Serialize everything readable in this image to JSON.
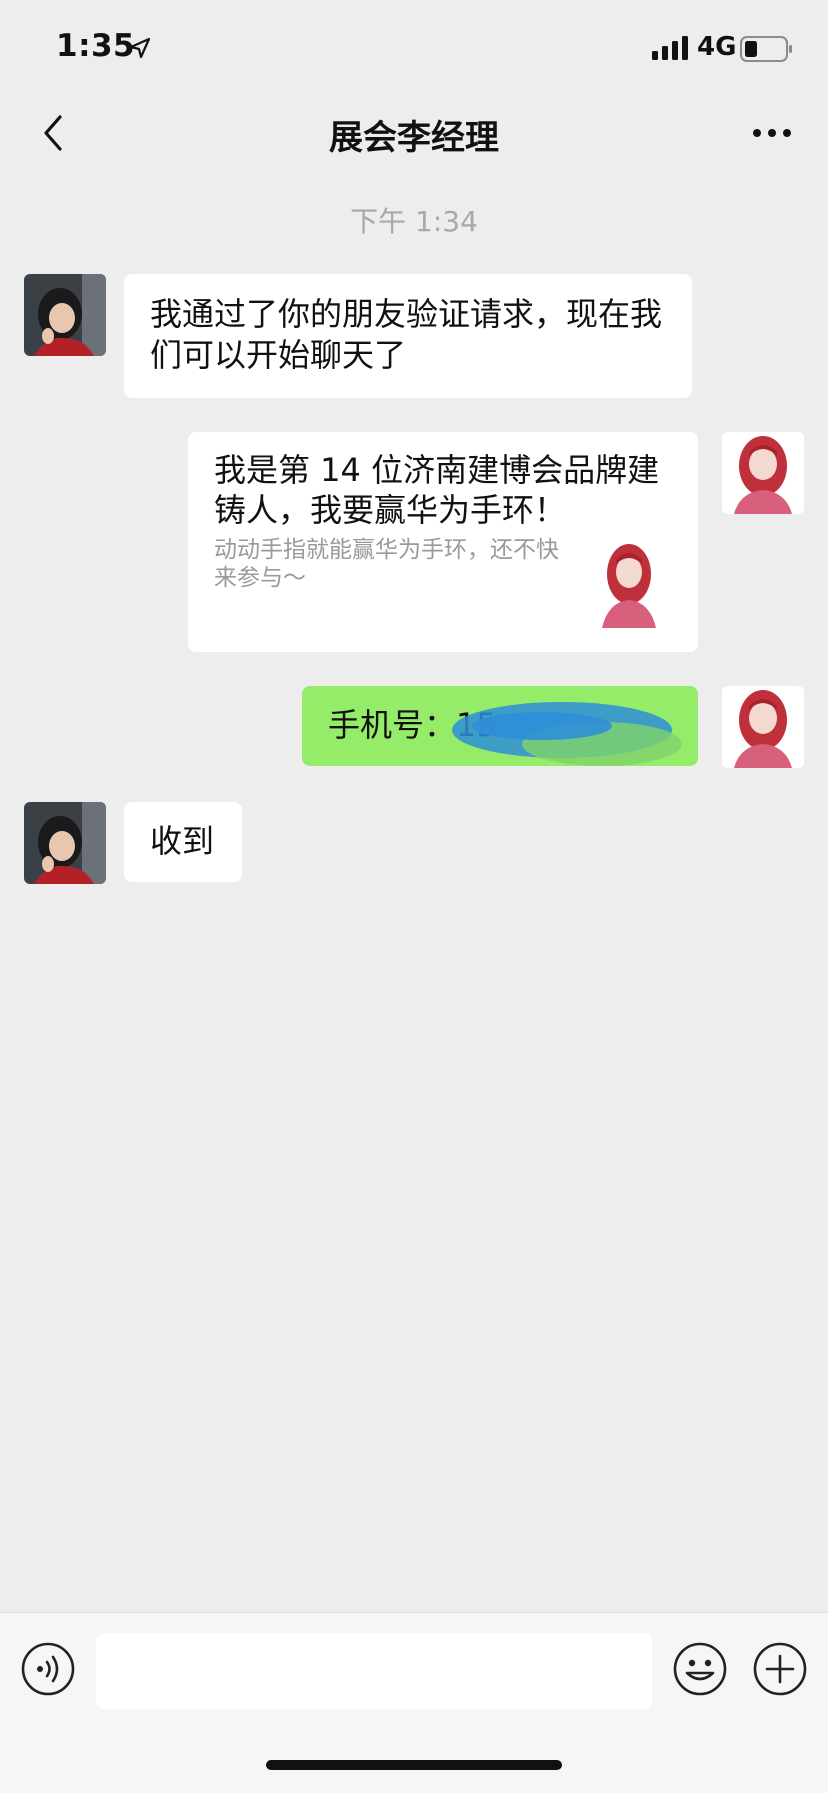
{
  "status_bar": {
    "time": "1:35",
    "network": "4G",
    "icons": [
      "location-arrow-icon",
      "signal-bars-icon",
      "battery-icon"
    ]
  },
  "nav": {
    "title": "展会李经理",
    "back_icon": "chevron-left-icon",
    "more_icon": "more-dots-icon"
  },
  "chat": {
    "timestamp": "下午 1:34",
    "messages": [
      {
        "sender": "other",
        "text": "我通过了你的朋友验证请求，现在我们可以开始聊天了"
      },
      {
        "sender": "self",
        "type": "link-card",
        "title": "我是第 14 位济南建博会品牌建铸人，我要赢华为手环！",
        "description": "动动手指就能赢华为手环，还不快来参与～"
      },
      {
        "sender": "self",
        "text": "手机号：15"
      },
      {
        "sender": "other",
        "text": "收到"
      }
    ]
  },
  "input_bar": {
    "placeholder": "",
    "icons": [
      "voice-icon",
      "emoji-icon",
      "plus-icon"
    ]
  },
  "colors": {
    "background": "#ededed",
    "bubble_self": "#95ec69",
    "bubble_other": "#ffffff",
    "redaction": "#2f8fd8"
  }
}
